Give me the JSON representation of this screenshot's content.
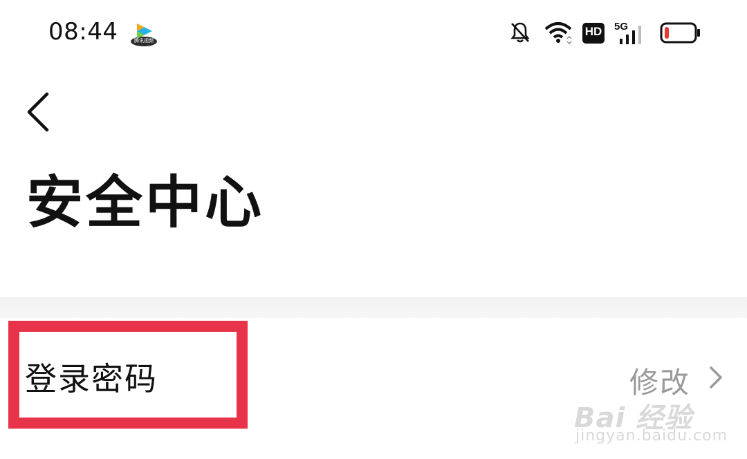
{
  "status_bar": {
    "time": "08:44",
    "app_icon_text": "腾讯视频",
    "icons": [
      "bell-muted-icon",
      "wifi-icon",
      "hd-icon",
      "signal-5g-icon",
      "battery-low-icon"
    ],
    "hd_label": "HD",
    "network_label": "5G",
    "battery_color": "#e53935",
    "battery_level": 0.15
  },
  "header": {
    "back_icon": "chevron-left-icon",
    "title": "安全中心"
  },
  "settings": {
    "rows": [
      {
        "label": "登录密码",
        "action": "修改",
        "icon": "chevron-right-icon",
        "highlighted": true
      }
    ]
  },
  "highlight_color": "#e8344a",
  "watermark": {
    "main": "Bai 经验",
    "sub": "jingyan.baidu.com"
  }
}
